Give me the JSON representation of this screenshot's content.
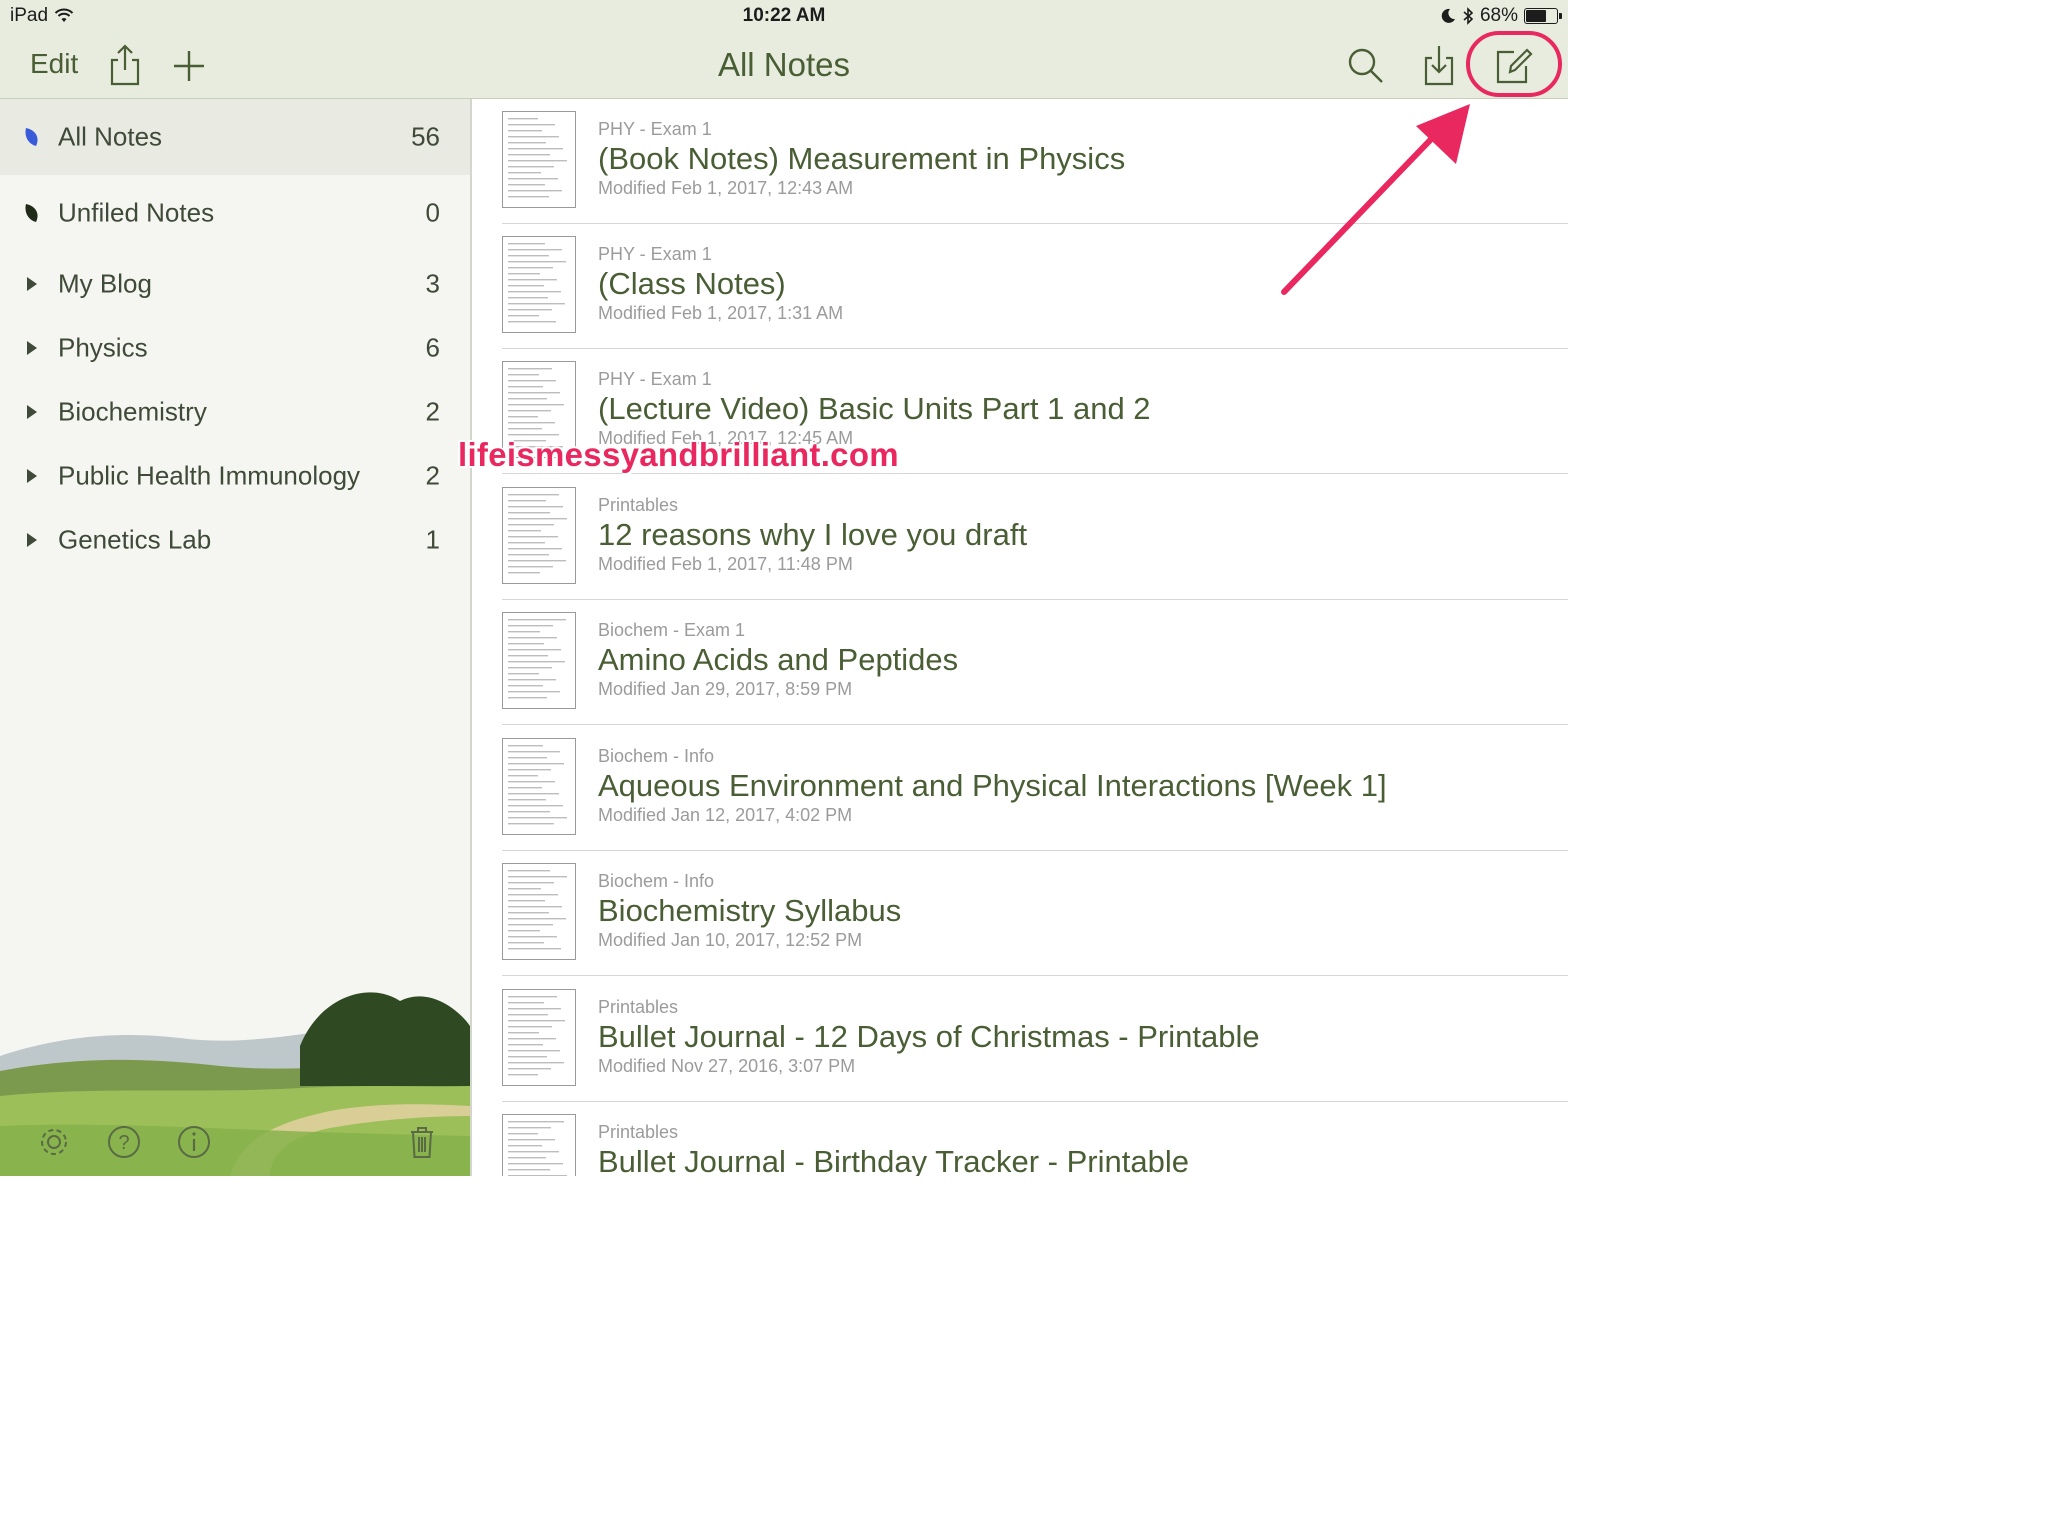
{
  "status_bar": {
    "device": "iPad",
    "time": "10:22 AM",
    "battery": "68%",
    "battery_level": 0.68
  },
  "nav": {
    "edit": "Edit",
    "title": "All Notes",
    "icons": [
      "share-icon",
      "plus-icon",
      "search-icon",
      "download-icon",
      "compose-icon"
    ]
  },
  "sidebar": {
    "items": [
      {
        "label": "All Notes",
        "count": "56",
        "icon": "leaf-icon"
      },
      {
        "label": "Unfiled Notes",
        "count": "0",
        "icon": "leaf-icon"
      },
      {
        "label": "My Blog",
        "count": "3",
        "icon": "disclosure-triangle-icon"
      },
      {
        "label": "Physics",
        "count": "6",
        "icon": "disclosure-triangle-icon"
      },
      {
        "label": "Biochemistry",
        "count": "2",
        "icon": "disclosure-triangle-icon"
      },
      {
        "label": "Public Health Immunology",
        "count": "2",
        "icon": "disclosure-triangle-icon"
      },
      {
        "label": "Genetics Lab",
        "count": "1",
        "icon": "disclosure-triangle-icon"
      }
    ],
    "tools": [
      "settings-icon",
      "help-icon",
      "info-icon",
      "trash-icon"
    ]
  },
  "notes": [
    {
      "notebook": "PHY - Exam 1",
      "title": "(Book Notes) Measurement in Physics",
      "modified": "Modified Feb 1, 2017, 12:43 AM"
    },
    {
      "notebook": "PHY - Exam 1",
      "title": "(Class Notes)",
      "modified": "Modified Feb 1, 2017, 1:31 AM"
    },
    {
      "notebook": "PHY - Exam 1",
      "title": "(Lecture Video) Basic Units Part 1 and 2",
      "modified": "Modified Feb 1, 2017, 12:45 AM"
    },
    {
      "notebook": "Printables",
      "title": "12 reasons why I love you draft",
      "modified": "Modified Feb 1, 2017, 11:48 PM"
    },
    {
      "notebook": "Biochem - Exam 1",
      "title": "Amino Acids and Peptides",
      "modified": "Modified Jan 29, 2017, 8:59 PM"
    },
    {
      "notebook": "Biochem - Info",
      "title": "Aqueous Environment and Physical Interactions [Week 1]",
      "modified": "Modified Jan 12, 2017, 4:02 PM"
    },
    {
      "notebook": "Biochem - Info",
      "title": "Biochemistry Syllabus",
      "modified": "Modified Jan 10, 2017, 12:52 PM"
    },
    {
      "notebook": "Printables",
      "title": "Bullet Journal - 12 Days of Christmas - Printable",
      "modified": "Modified Nov 27, 2016, 3:07 PM"
    },
    {
      "notebook": "Printables",
      "title": "Bullet Journal - Birthday Tracker - Printable",
      "modified": ""
    }
  ],
  "watermark": "lifeismessyandbrilliant.com",
  "colors": {
    "accent": "#4a5e35",
    "bar": "#e8ecde",
    "highlight": "#e8285f",
    "selected_leaf": "#3a5bd9"
  }
}
